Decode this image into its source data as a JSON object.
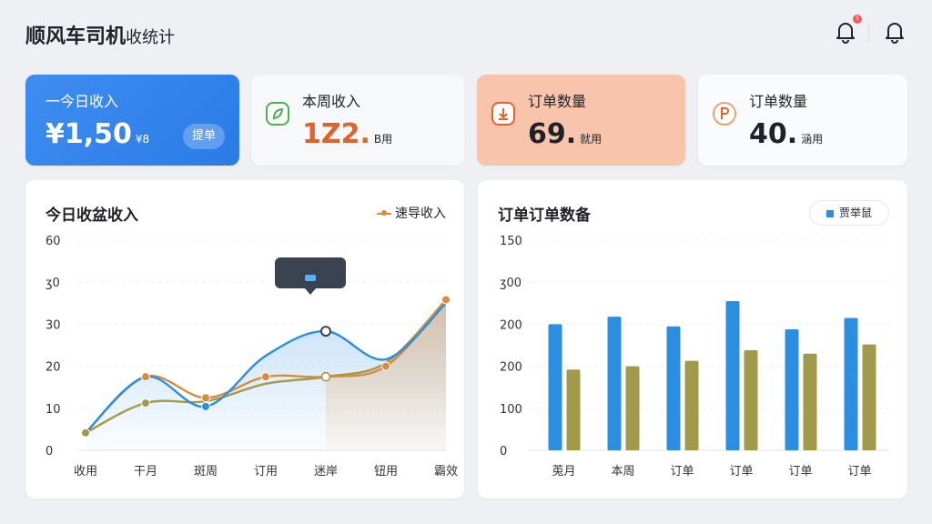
{
  "header": {
    "title_main": "顺风车司机",
    "title_sub": "收统计",
    "badge": "5",
    "icons": [
      "bell-badge-icon",
      "bell-icon"
    ]
  },
  "cards": [
    {
      "label": "一今日收入",
      "value": "¥1,50",
      "unit": "¥8",
      "button": "提单",
      "icon": ""
    },
    {
      "label": "本周收入",
      "value": "1Z2.",
      "unit": "B用",
      "icon": "leaf-icon"
    },
    {
      "label": "订单数量",
      "value": "69.",
      "unit": "就用",
      "icon": "download-icon"
    },
    {
      "label": "订单数量",
      "value": "40.",
      "unit": "涵用",
      "icon": "parking-icon"
    }
  ],
  "colors": {
    "blue": "#2b8ee0",
    "orange": "#d88a3e",
    "olive": "#a09a4a",
    "salmon": "#f8c4ab"
  },
  "line_chart": {
    "title": "今日收盆收入",
    "legend": "速导收入"
  },
  "bar_chart": {
    "title": "订单订单数备",
    "legend": "贾举鼠"
  },
  "chart_data": [
    {
      "type": "line",
      "title": "今日收盆收入",
      "categories": [
        "收用",
        "干月",
        "斑周",
        "订用",
        "迷岸",
        "钮用",
        "霸效"
      ],
      "yticks": [
        "0",
        "10",
        "20",
        "30",
        "ʒ0",
        "60"
      ],
      "ylim": [
        0,
        60
      ],
      "grid": true,
      "legend_position": "top-right",
      "series": [
        {
          "name": "速导收入",
          "values": [
            5,
            21,
            15,
            21,
            21,
            24,
            43
          ],
          "color": "#d88a3e"
        },
        {
          "values": [
            5,
            21,
            12.5,
            27,
            34,
            26,
            42
          ],
          "color": "#2b8ee0"
        },
        {
          "values": [
            5,
            13.5,
            14,
            19,
            21,
            25,
            43
          ],
          "color": "#a09a4a"
        }
      ]
    },
    {
      "type": "bar",
      "title": "订单订单数备",
      "categories": [
        "莵月",
        "本周",
        "订单",
        "订单",
        "订单",
        "订单"
      ],
      "yticks": [
        "0",
        "100",
        "200",
        "200",
        "ʒ00",
        "150"
      ],
      "ylim": [
        0,
        5
      ],
      "grid": true,
      "legend_position": "top-right",
      "series": [
        {
          "name": "贾举鼠",
          "values": [
            3,
            3.18,
            2.95,
            3.55,
            2.88,
            3.15
          ],
          "color": "#2b8ee0"
        },
        {
          "values": [
            1.92,
            2,
            2.13,
            2.38,
            2.3,
            2.52
          ],
          "color": "#a09a4a"
        }
      ]
    }
  ]
}
